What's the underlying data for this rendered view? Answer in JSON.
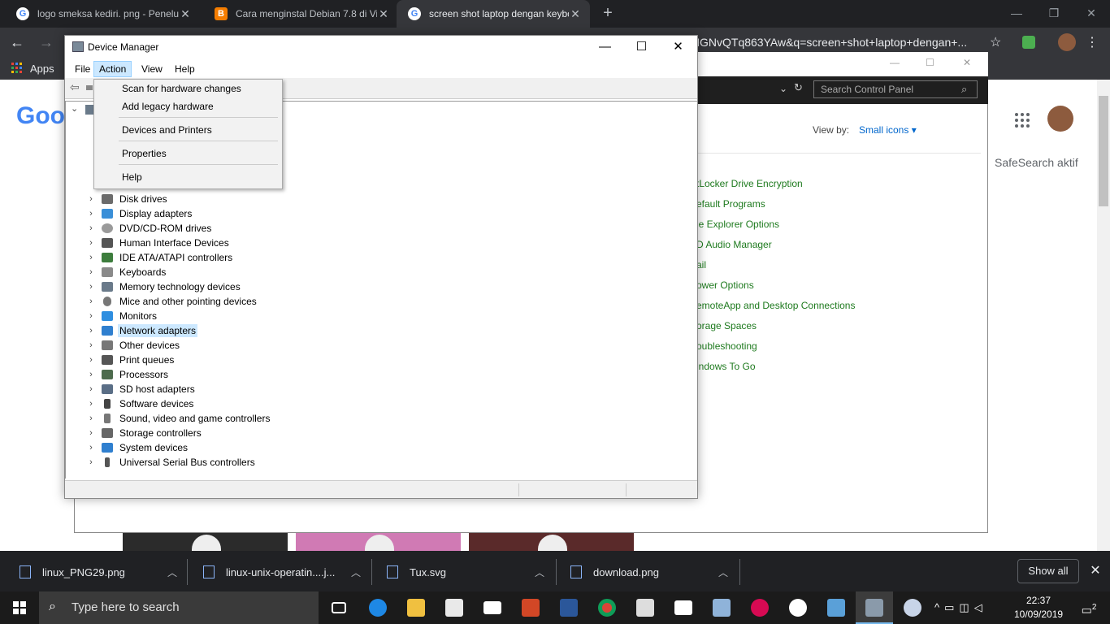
{
  "browser": {
    "tabs": [
      {
        "title": "logo smeksa kediri. png - Penelu",
        "favicon": "google-icon"
      },
      {
        "title": "Cara menginstal Debian 7.8 di Vi",
        "favicon": "blogger-icon"
      },
      {
        "title": "screen shot laptop dengan keybo",
        "favicon": "google-icon"
      }
    ],
    "url": "PMGNvQTq863YAw&q=screen+shot+laptop+dengan+...",
    "bookmarks": {
      "apps_label": "Apps"
    },
    "google_logo": "Goog",
    "safesearch": "SafeSearch aktif",
    "downloads": [
      {
        "name": "linux_PNG29.png"
      },
      {
        "name": "linux-unix-operatin....j..."
      },
      {
        "name": "Tux.svg"
      },
      {
        "name": "download.png"
      }
    ],
    "show_all": "Show all"
  },
  "control_panel": {
    "search_placeholder": "Search Control Panel",
    "view_by_label": "View by:",
    "view_by_value": "Small icons",
    "items": [
      "tLocker Drive Encryption",
      "efault Programs",
      "le Explorer Options",
      "D Audio Manager",
      "ail",
      "ower Options",
      "emoteApp and Desktop Connections",
      "orage Spaces",
      "oubleshooting",
      "indows To Go"
    ]
  },
  "device_manager": {
    "title": "Device Manager",
    "menu": [
      "File",
      "Action",
      "View",
      "Help"
    ],
    "action_menu": [
      "Scan for hardware changes",
      "Add legacy hardware",
      "Devices and Printers",
      "Properties",
      "Help"
    ],
    "tree": [
      {
        "label": "Disk drives",
        "icon": "disk-drive-icon",
        "color": "#6b6b6b"
      },
      {
        "label": "Display adapters",
        "icon": "display-adapter-icon",
        "color": "#3a8fd8"
      },
      {
        "label": "DVD/CD-ROM drives",
        "icon": "dvd-drive-icon",
        "color": "#9a9a9a"
      },
      {
        "label": "Human Interface Devices",
        "icon": "hid-icon",
        "color": "#555555"
      },
      {
        "label": "IDE ATA/ATAPI controllers",
        "icon": "ide-controller-icon",
        "color": "#3d7d3d"
      },
      {
        "label": "Keyboards",
        "icon": "keyboard-icon",
        "color": "#8a8a8a"
      },
      {
        "label": "Memory technology devices",
        "icon": "memory-device-icon",
        "color": "#6a7a8a"
      },
      {
        "label": "Mice and other pointing devices",
        "icon": "mouse-icon",
        "color": "#777777"
      },
      {
        "label": "Monitors",
        "icon": "monitor-icon",
        "color": "#2e8ee0"
      },
      {
        "label": "Network adapters",
        "icon": "network-adapter-icon",
        "color": "#2f7fcf",
        "selected": true
      },
      {
        "label": "Other devices",
        "icon": "unknown-device-icon",
        "color": "#777777"
      },
      {
        "label": "Print queues",
        "icon": "printer-icon",
        "color": "#555555"
      },
      {
        "label": "Processors",
        "icon": "processor-icon",
        "color": "#4d6b4d"
      },
      {
        "label": "SD host adapters",
        "icon": "sd-adapter-icon",
        "color": "#5a6e86"
      },
      {
        "label": "Software devices",
        "icon": "software-device-icon",
        "color": "#444444"
      },
      {
        "label": "Sound, video and game controllers",
        "icon": "sound-icon",
        "color": "#777777"
      },
      {
        "label": "Storage controllers",
        "icon": "storage-controller-icon",
        "color": "#666666"
      },
      {
        "label": "System devices",
        "icon": "system-device-icon",
        "color": "#2f7fcf"
      },
      {
        "label": "Universal Serial Bus controllers",
        "icon": "usb-icon",
        "color": "#555555"
      }
    ]
  },
  "taskbar": {
    "search_placeholder": "Type here to search",
    "time": "22:37",
    "date": "10/09/2019",
    "notification_count": "2"
  },
  "colors": {
    "accent": "#0078d7",
    "chrome_dark": "#202124",
    "link_green": "#1e7a1e"
  }
}
